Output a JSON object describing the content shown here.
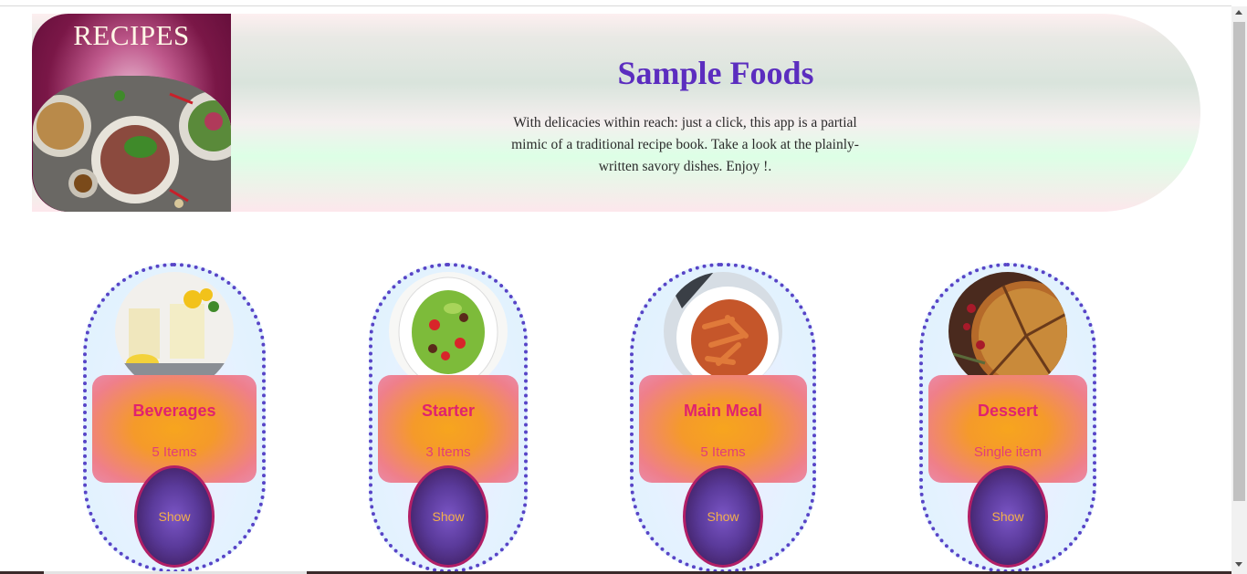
{
  "header": {
    "brand": "RECIPES",
    "title": "Sample Foods",
    "intro": "With delicacies within reach: just a click, this app is a partial mimic of a traditional recipe book. Take a look at the plainly-written savory dishes. Enjoy !."
  },
  "categories": [
    {
      "name": "Beverages",
      "count": "5 Items",
      "button": "Show"
    },
    {
      "name": "Starter",
      "count": "3 Items",
      "button": "Show"
    },
    {
      "name": "Main Meal",
      "count": "5 Items",
      "button": "Show"
    },
    {
      "name": "Dessert",
      "count": "Single item",
      "button": "Show"
    }
  ]
}
